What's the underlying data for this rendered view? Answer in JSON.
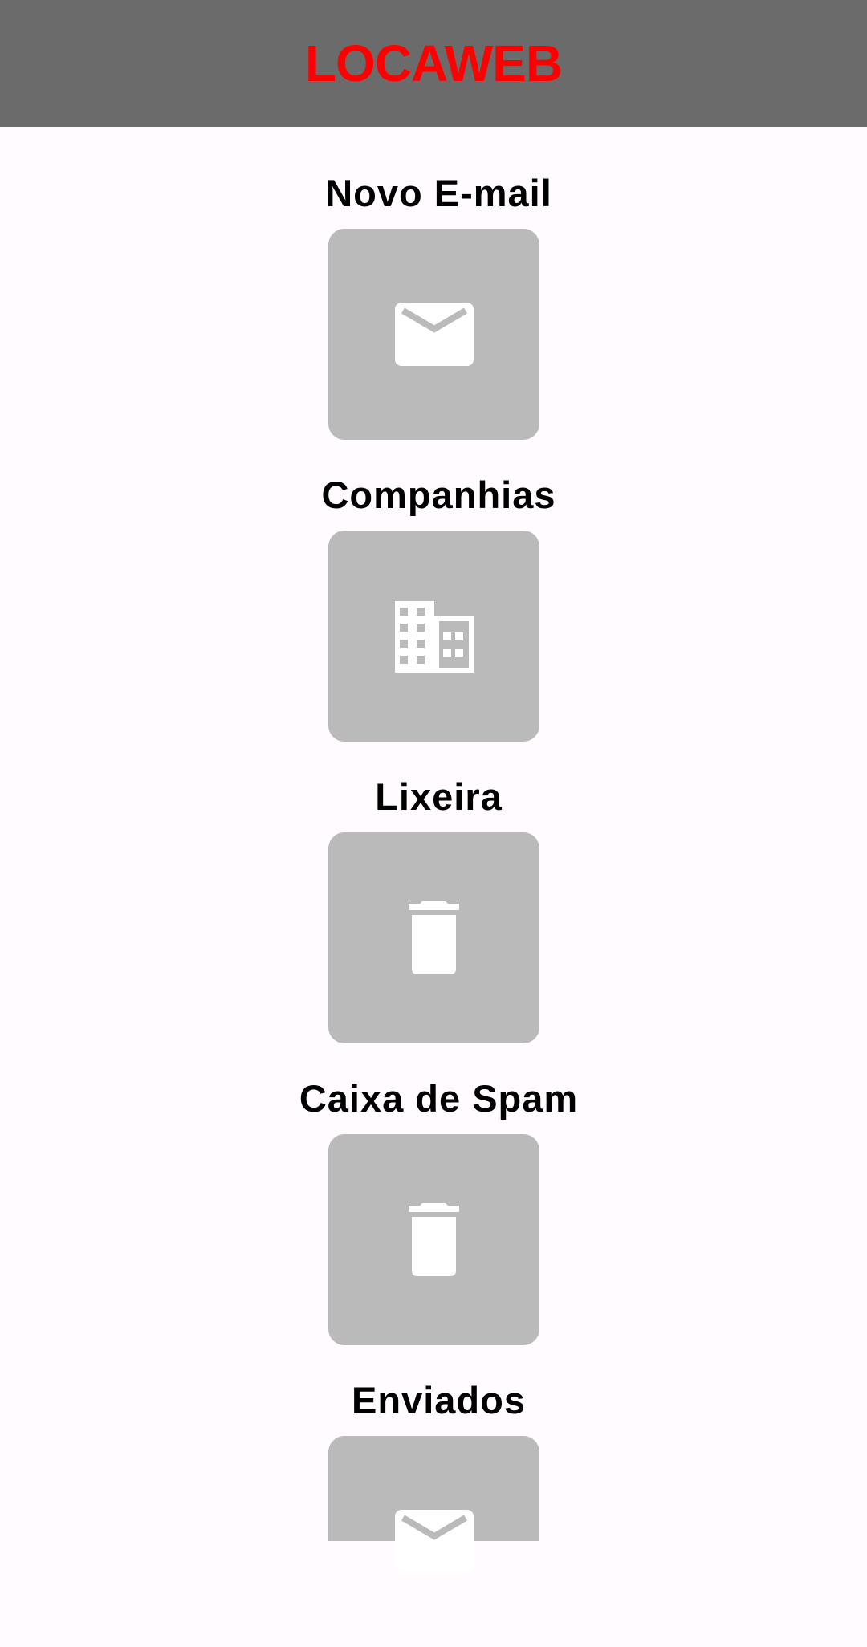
{
  "app_bar": {
    "title": "LOCAWEB",
    "title_color": "#ff0000",
    "background": "#6b6b6b"
  },
  "menu": {
    "tile_color": "#bababa",
    "icon_color": "#ffffff",
    "items": [
      {
        "label": "Novo E-mail",
        "icon": "mail-icon"
      },
      {
        "label": "Companhias",
        "icon": "building-icon"
      },
      {
        "label": "Lixeira",
        "icon": "trash-icon"
      },
      {
        "label": "Caixa de Spam",
        "icon": "trash-icon"
      },
      {
        "label": "Enviados",
        "icon": "mail-icon"
      }
    ]
  }
}
